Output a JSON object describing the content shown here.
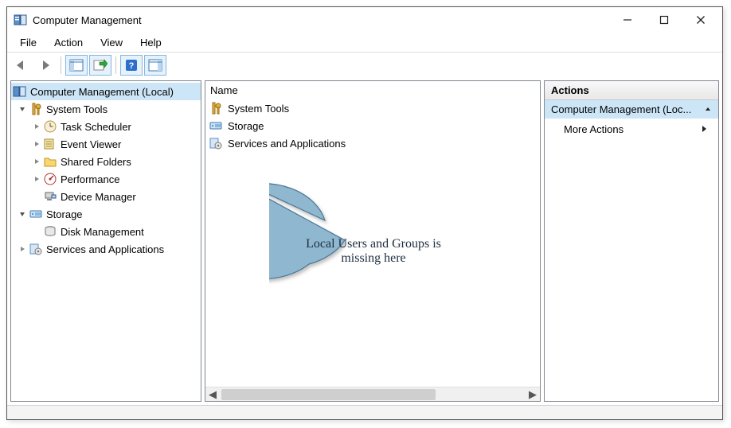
{
  "window": {
    "title": "Computer Management"
  },
  "menu": {
    "file": "File",
    "action": "Action",
    "view": "View",
    "help": "Help"
  },
  "tree": {
    "root": {
      "label": "Computer Management (Local)"
    },
    "systemTools": {
      "label": "System Tools"
    },
    "taskScheduler": {
      "label": "Task Scheduler"
    },
    "eventViewer": {
      "label": "Event Viewer"
    },
    "sharedFolders": {
      "label": "Shared Folders"
    },
    "performance": {
      "label": "Performance"
    },
    "deviceManager": {
      "label": "Device Manager"
    },
    "storage": {
      "label": "Storage"
    },
    "diskManagement": {
      "label": "Disk Management"
    },
    "servicesApps": {
      "label": "Services and Applications"
    }
  },
  "list": {
    "headerName": "Name",
    "items": {
      "systemTools": "System Tools",
      "storage": "Storage",
      "servicesApps": "Services and Applications"
    }
  },
  "actions": {
    "header": "Actions",
    "group": "Computer Management (Loc...",
    "more": "More Actions"
  },
  "callout": {
    "text": "Local Users and Groups is missing here"
  }
}
